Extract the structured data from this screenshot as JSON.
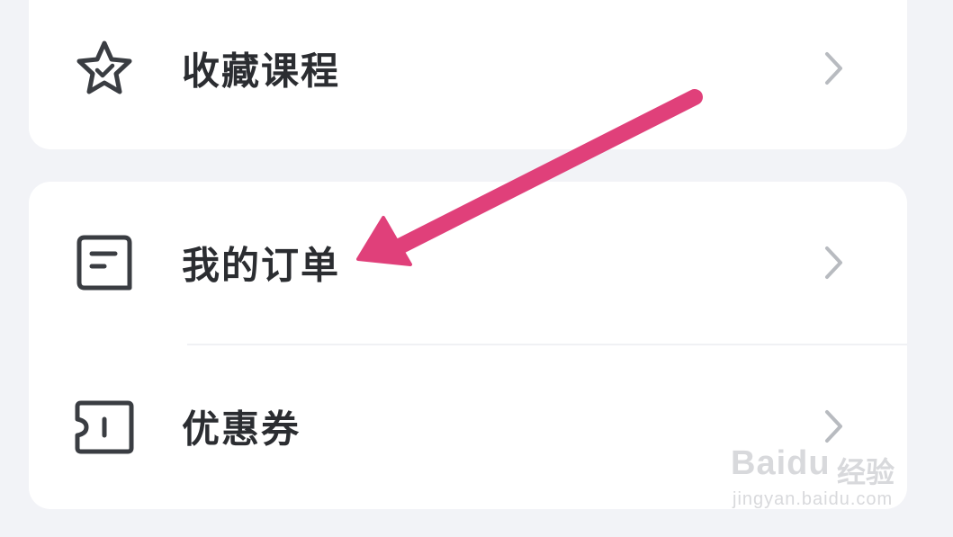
{
  "menu": {
    "favorites_label": "收藏课程",
    "orders_label": "我的订单",
    "coupons_label": "优惠券"
  },
  "icons": {
    "favorites": "star-check-icon",
    "orders": "order-doc-icon",
    "coupons": "ticket-icon",
    "chevron": "chevron-right-icon",
    "annotation": "pink-arrow"
  },
  "colors": {
    "background": "#f2f3f7",
    "card": "#ffffff",
    "text": "#2b2d31",
    "icon": "#3a3d42",
    "chevron": "#b8bbc0",
    "arrow": "#e0407a"
  },
  "watermark": {
    "logo": "Baidu",
    "cn": "经验",
    "url": "jingyan.baidu.com"
  }
}
